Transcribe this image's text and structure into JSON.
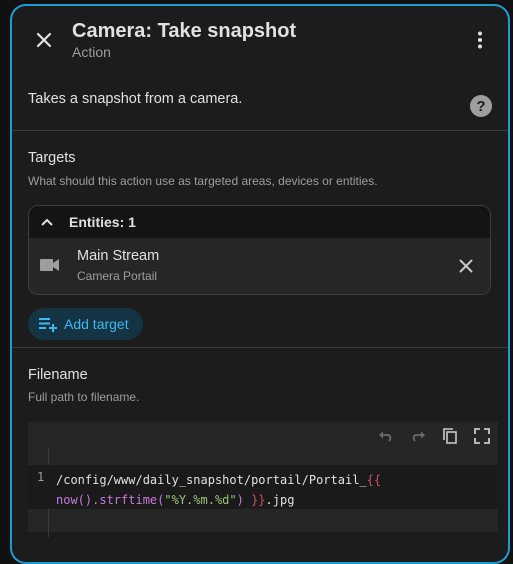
{
  "dialog": {
    "title": "Camera: Take snapshot",
    "subtitle": "Action",
    "description": "Takes a snapshot from a camera."
  },
  "targets": {
    "title": "Targets",
    "hint": "What should this action use as targeted areas, devices or entities.",
    "entities_header": "Entities: 1",
    "entity": {
      "name": "Main Stream",
      "area": "Camera Portail",
      "icon": "video-camera-icon"
    },
    "add_label": "Add target"
  },
  "filename": {
    "title": "Filename",
    "hint": "Full path to filename.",
    "line_number": "1",
    "code_line1_path": "/config/www/daily_snapshot/portail/Portail_",
    "code_line1_brace": "{{",
    "code_line2_fn": "now().strftime(",
    "code_line2_str": "\"%Y.%m.%d\"",
    "code_line2_close": ") ",
    "code_line2_brace": "}}",
    "code_line2_ext": ".jpg"
  },
  "colors": {
    "accent": "#1d9bd1",
    "link": "#3fb8f1",
    "brace": "#c8526e",
    "function": "#c678dd",
    "string": "#98c379"
  }
}
